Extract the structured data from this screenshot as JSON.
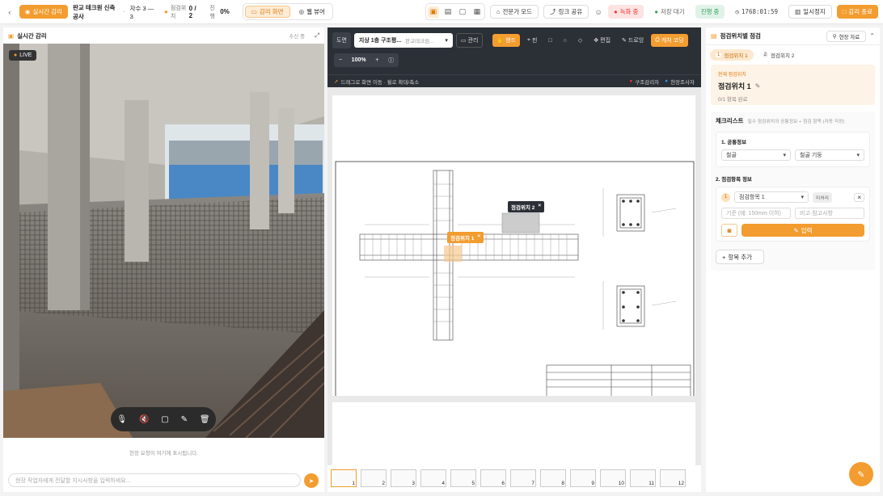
{
  "header": {
    "back_icon": "chevron-left-icon",
    "live_label": "실시간 감리",
    "project": "판교 테크원 신축공사",
    "sep": "·",
    "floor": "자수 3 — 3",
    "inspect_label": "점검위치",
    "inspect_value": "0 / 2",
    "progress_label": "진행",
    "progress_value": "0%",
    "tab_screen": "감리 화면",
    "tab_web": "웹 뷰어",
    "expert_mode": "전문가 모드",
    "share_link": "링크 공유",
    "recording": "녹화 중",
    "standby": "저장 대기",
    "status": "진행 중",
    "timer": "1768:01:59",
    "pause": "일시정지",
    "end": "감리 종료"
  },
  "left": {
    "title": "실시간 감리",
    "signal": "수신 중",
    "live": "LIVE",
    "note": "현장 요청이 여기에 표시됩니다.",
    "input_placeholder": "현장 작업자에게 전달할 지시사항을 입력하세요..."
  },
  "drawing": {
    "tab": "도면",
    "doc_title": "지상 1층 구조평...",
    "doc_select": "판교테크원...",
    "manage": "관리",
    "tool_hand": "핸드",
    "tool_pin": "핀",
    "tool_edit": "편집",
    "tool_drawing": "드로잉",
    "capture": "캐처 코딩",
    "zoom": "100%",
    "hint": "드래그로 화면 이동 · 휠로 확대/축소",
    "legend_a": "구조감리자",
    "legend_b": "현장조사자",
    "marker1": "점검위치 1",
    "marker2": "점검위치 2",
    "pages": [
      "1",
      "2",
      "3",
      "4",
      "5",
      "6",
      "7",
      "8",
      "9",
      "10",
      "11",
      "12"
    ]
  },
  "right": {
    "title": "점검위치별 점검",
    "ref": "현장 자료",
    "tab1": "점검위치 1",
    "tab2": "점검위치 2",
    "current_label": "현재 점검위치",
    "current_name": "점검위치 1",
    "progress": "0/1 항목 완료",
    "checklist": "체크리스트",
    "checklist_sub": "필수 점검위치의 공통정보 + 점검 항목 (자동 저장)",
    "sec1": "1. 공통정보",
    "sel1": "철골",
    "sel2": "철골 기둥",
    "sec2": "2. 점검항목 정보",
    "item_no": "1",
    "item_name": "점검항목 1",
    "item_badge": "미처리",
    "std_placeholder": "기준 (예: 150mm 이하)",
    "note_placeholder": "비고·참고사항",
    "record": "입력",
    "add_item": "항목 추가"
  },
  "colors": {
    "accent": "#f39c2f",
    "dark": "#2b2f36",
    "red": "#e53935",
    "green": "#2e9e5b"
  }
}
